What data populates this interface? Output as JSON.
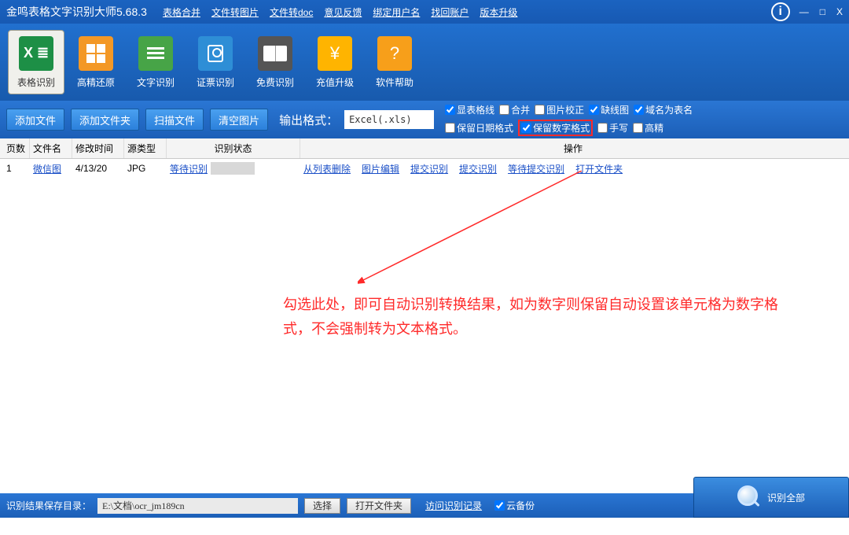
{
  "title": "金鸣表格文字识别大师5.68.3",
  "menu": [
    "表格合并",
    "文件转图片",
    "文件转doc",
    "意见反馈",
    "绑定用户名",
    "找回账户",
    "版本升级"
  ],
  "winbtns": {
    "min": "—",
    "max": "□",
    "close": "X"
  },
  "tools": [
    {
      "label": "表格识别",
      "icon": "excel"
    },
    {
      "label": "高精还原",
      "icon": "orange"
    },
    {
      "label": "文字识别",
      "icon": "green"
    },
    {
      "label": "证票识别",
      "icon": "blue"
    },
    {
      "label": "免费识别",
      "icon": "dark"
    },
    {
      "label": "充值升级",
      "icon": "coin"
    },
    {
      "label": "软件帮助",
      "icon": "help"
    }
  ],
  "optbtns": [
    "添加文件",
    "添加文件夹",
    "扫描文件",
    "清空图片"
  ],
  "outlabel": "输出格式：",
  "outvalue": "Excel(.xls)",
  "checks_row1": [
    {
      "label": "显表格线",
      "checked": true
    },
    {
      "label": "合并",
      "checked": false
    },
    {
      "label": "图片校正",
      "checked": false
    },
    {
      "label": "缺线图",
      "checked": true
    },
    {
      "label": "域名为表名",
      "checked": true
    }
  ],
  "checks_row2": [
    {
      "label": "保留日期格式",
      "checked": false
    },
    {
      "label": "保留数字格式",
      "checked": true,
      "highlight": true
    },
    {
      "label": "手写",
      "checked": false
    },
    {
      "label": "高精",
      "checked": false
    }
  ],
  "columns": {
    "page": "页数",
    "file": "文件名",
    "mtime": "修改时间",
    "type": "源类型",
    "status": "识别状态",
    "ops": "操作"
  },
  "row": {
    "page": "1",
    "file": "微信图",
    "mtime": "4/13/20",
    "type": "JPG",
    "status": "等待识别",
    "ops": [
      "从列表删除",
      "图片编辑",
      "提交识别",
      "提交识别",
      "等待提交识别",
      "打开文件夹"
    ]
  },
  "annotation": "勾选此处，即可自动识别转换结果，如为数字则保留自动设置该单元格为数字格式，不会强制转为文本格式。",
  "status": {
    "label": "识别结果保存目录：",
    "path": "E:\\文档\\ocr_jm189cn",
    "browse": "选择",
    "open": "打开文件夹",
    "history": "访问识别记录",
    "cloud": "云备份",
    "cloud_checked": true,
    "bigbtn": "识别全部"
  }
}
